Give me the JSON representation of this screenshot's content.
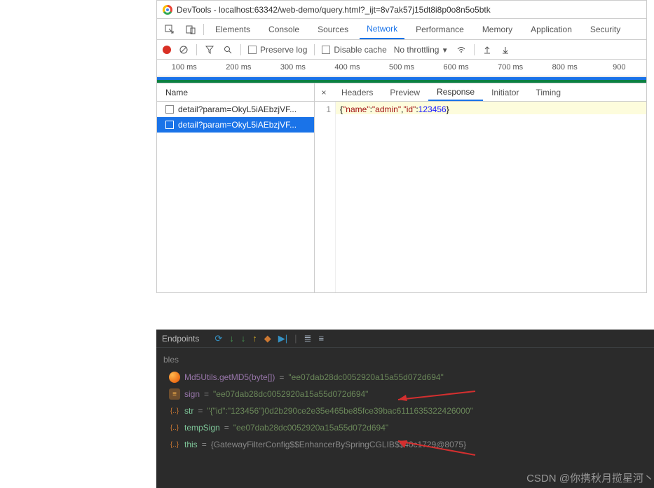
{
  "devtools": {
    "title": "DevTools - localhost:63342/web-demo/query.html?_ijt=8v7ak57j15dt8i8p0o8n5o5btk",
    "topTabs": [
      "Elements",
      "Console",
      "Sources",
      "Network",
      "Performance",
      "Memory",
      "Application",
      "Security"
    ],
    "activeTopTab": "Network",
    "toolbar": {
      "preserveLog": "Preserve log",
      "disableCache": "Disable cache",
      "throttling": "No throttling"
    },
    "timeline": [
      "100 ms",
      "200 ms",
      "300 ms",
      "400 ms",
      "500 ms",
      "600 ms",
      "700 ms",
      "800 ms",
      "900"
    ],
    "nameHeader": "Name",
    "requests": [
      {
        "label": "detail?param=OkyL5iAEbzjVF...",
        "selected": false
      },
      {
        "label": "detail?param=OkyL5iAEbzjVF...",
        "selected": true
      }
    ],
    "detailTabs": [
      "Headers",
      "Preview",
      "Response",
      "Initiator",
      "Timing"
    ],
    "activeDetailTab": "Response",
    "responseLineNo": "1",
    "response": {
      "raw": "{\"name\":\"admin\",\"id\":123456}",
      "k1": "\"name\"",
      "v1": "\"admin\"",
      "k2": "\"id\"",
      "v2": "123456"
    }
  },
  "ide": {
    "endpointsTab": "Endpoints",
    "sectionLabel": "bles",
    "vars": {
      "md5": {
        "call": "Md5Utils.getMD5(byte[])",
        "eq": " = ",
        "val": "\"ee07dab28dc0052920a15a55d072d694\""
      },
      "sign": {
        "name": "sign",
        "eq": " = ",
        "val": "\"ee07dab28dc0052920a15a55d072d694\""
      },
      "str": {
        "name": "str",
        "eq": " = ",
        "val": "\"{\"id\":\"123456\"}0d2b290ce2e35e465be85fce39bac6111635322426000\""
      },
      "tempSign": {
        "name": "tempSign",
        "eq": " = ",
        "val": "\"ee07dab28dc0052920a15a55d072d694\""
      },
      "this": {
        "name": "this",
        "eq": " = ",
        "val": "{GatewayFilterConfig$$EnhancerBySpringCGLIB$$40c1729@8075}"
      }
    }
  },
  "watermark": "CSDN @你携秋月揽星河丶"
}
